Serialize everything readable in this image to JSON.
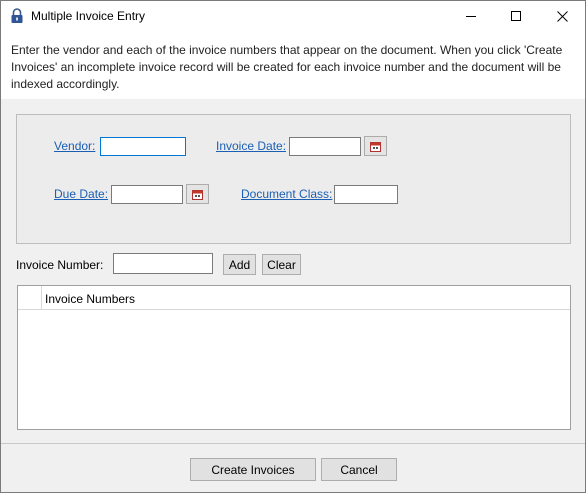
{
  "window": {
    "title": "Multiple Invoice Entry",
    "icon": "lock-icon",
    "controls": {
      "minimize": "minimize-icon",
      "maximize": "maximize-icon",
      "close": "close-icon"
    }
  },
  "instructions": "Enter the vendor and each of the invoice numbers that appear on the document. When you click 'Create Invoices' an incomplete invoice record will be created for each invoice number and the document will be indexed accordingly.",
  "form": {
    "vendor_label": "Vendor:",
    "vendor_value": "",
    "invoice_date_label": "Invoice Date:",
    "invoice_date_value": "",
    "due_date_label": "Due Date:",
    "due_date_value": "",
    "document_class_label": "Document Class:",
    "document_class_value": "",
    "calendar_icon": "calendar-icon"
  },
  "invoice_entry": {
    "label": "Invoice Number:",
    "value": "",
    "add_label": "Add",
    "clear_label": "Clear"
  },
  "grid": {
    "column_header": "Invoice Numbers",
    "rows": []
  },
  "footer": {
    "create_label": "Create Invoices",
    "cancel_label": "Cancel"
  },
  "colors": {
    "link": "#1a5fb4",
    "focus_border": "#0078d7",
    "dialog_background": "#f0f0f0"
  }
}
